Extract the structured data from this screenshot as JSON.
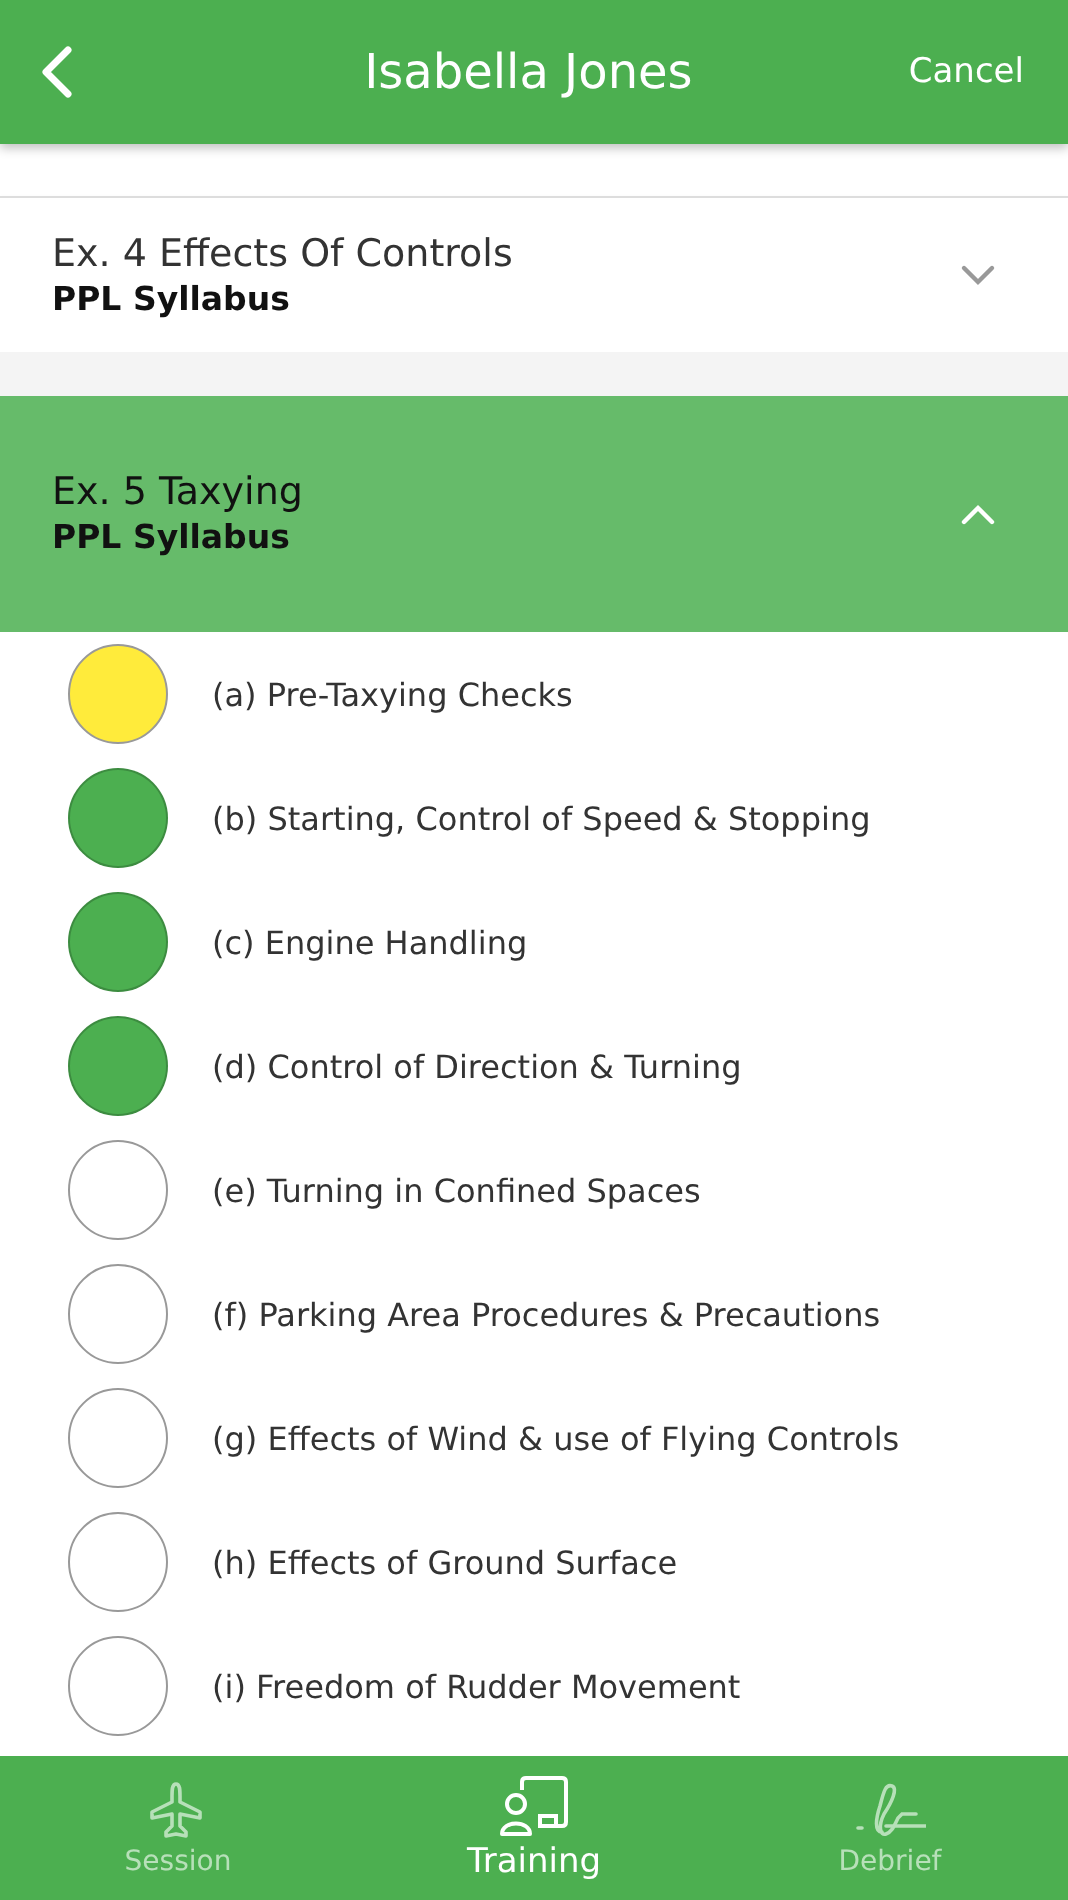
{
  "header": {
    "title": "Isabella Jones",
    "cancel": "Cancel"
  },
  "sections": [
    {
      "title": "Ex. 4 Effects Of Controls",
      "subtitle": "PPL Syllabus",
      "expanded": false
    },
    {
      "title": "Ex. 5 Taxying",
      "subtitle": "PPL Syllabus",
      "expanded": true,
      "items": [
        {
          "label": "(a) Pre-Taxying Checks",
          "color": "#ffeb3b"
        },
        {
          "label": "(b) Starting, Control of Speed & Stopping",
          "color": "#4caf50"
        },
        {
          "label": "(c) Engine Handling",
          "color": "#4caf50"
        },
        {
          "label": "(d) Control of Direction & Turning",
          "color": "#4caf50"
        },
        {
          "label": "(e) Turning in Confined Spaces",
          "color": "#ffffff"
        },
        {
          "label": "(f) Parking Area Procedures & Precautions",
          "color": "#ffffff"
        },
        {
          "label": "(g) Effects of Wind & use of Flying Controls",
          "color": "#ffffff"
        },
        {
          "label": "(h) Effects of Ground Surface",
          "color": "#ffffff"
        },
        {
          "label": "(i) Freedom of Rudder Movement",
          "color": "#ffffff"
        }
      ]
    }
  ],
  "tabs": [
    {
      "label": "Session",
      "selected": false
    },
    {
      "label": "Training",
      "selected": true
    },
    {
      "label": "Debrief",
      "selected": false
    }
  ]
}
